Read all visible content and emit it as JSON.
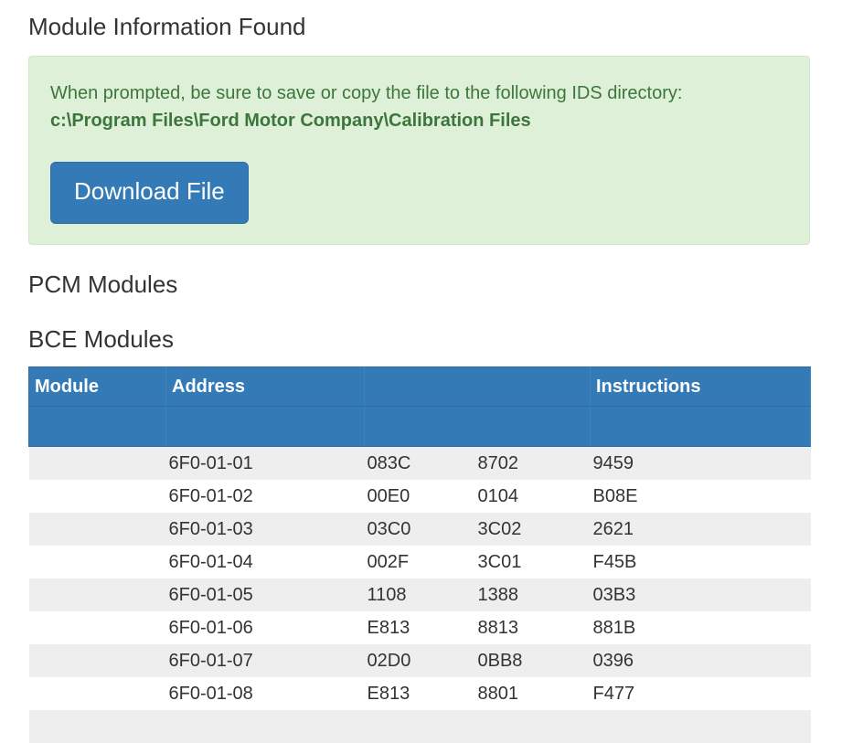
{
  "page": {
    "title": "Module Information Found",
    "alert": {
      "message": "When prompted, be sure to save or copy the file to the following IDS directory:",
      "path": "c:\\Program Files\\Ford Motor Company\\Calibration Files",
      "download_label": "Download File"
    },
    "pcm_heading": "PCM Modules",
    "bce_heading": "BCE Modules",
    "table": {
      "headers": [
        "Module",
        "Address",
        "",
        "Instructions"
      ],
      "rows": [
        [
          "",
          "6F0-01-01",
          "083C",
          "8702",
          "9459"
        ],
        [
          "",
          "6F0-01-02",
          "00E0",
          "0104",
          "B08E"
        ],
        [
          "",
          "6F0-01-03",
          "03C0",
          "3C02",
          "2621"
        ],
        [
          "",
          "6F0-01-04",
          "002F",
          "3C01",
          "F45B"
        ],
        [
          "",
          "6F0-01-05",
          "1108",
          "1388",
          "03B3"
        ],
        [
          "",
          "6F0-01-06",
          "E813",
          "8813",
          "881B"
        ],
        [
          "",
          "6F0-01-07",
          "02D0",
          "0BB8",
          "0396"
        ],
        [
          "",
          "6F0-01-08",
          "E813",
          "8801",
          "F477"
        ]
      ]
    }
  }
}
